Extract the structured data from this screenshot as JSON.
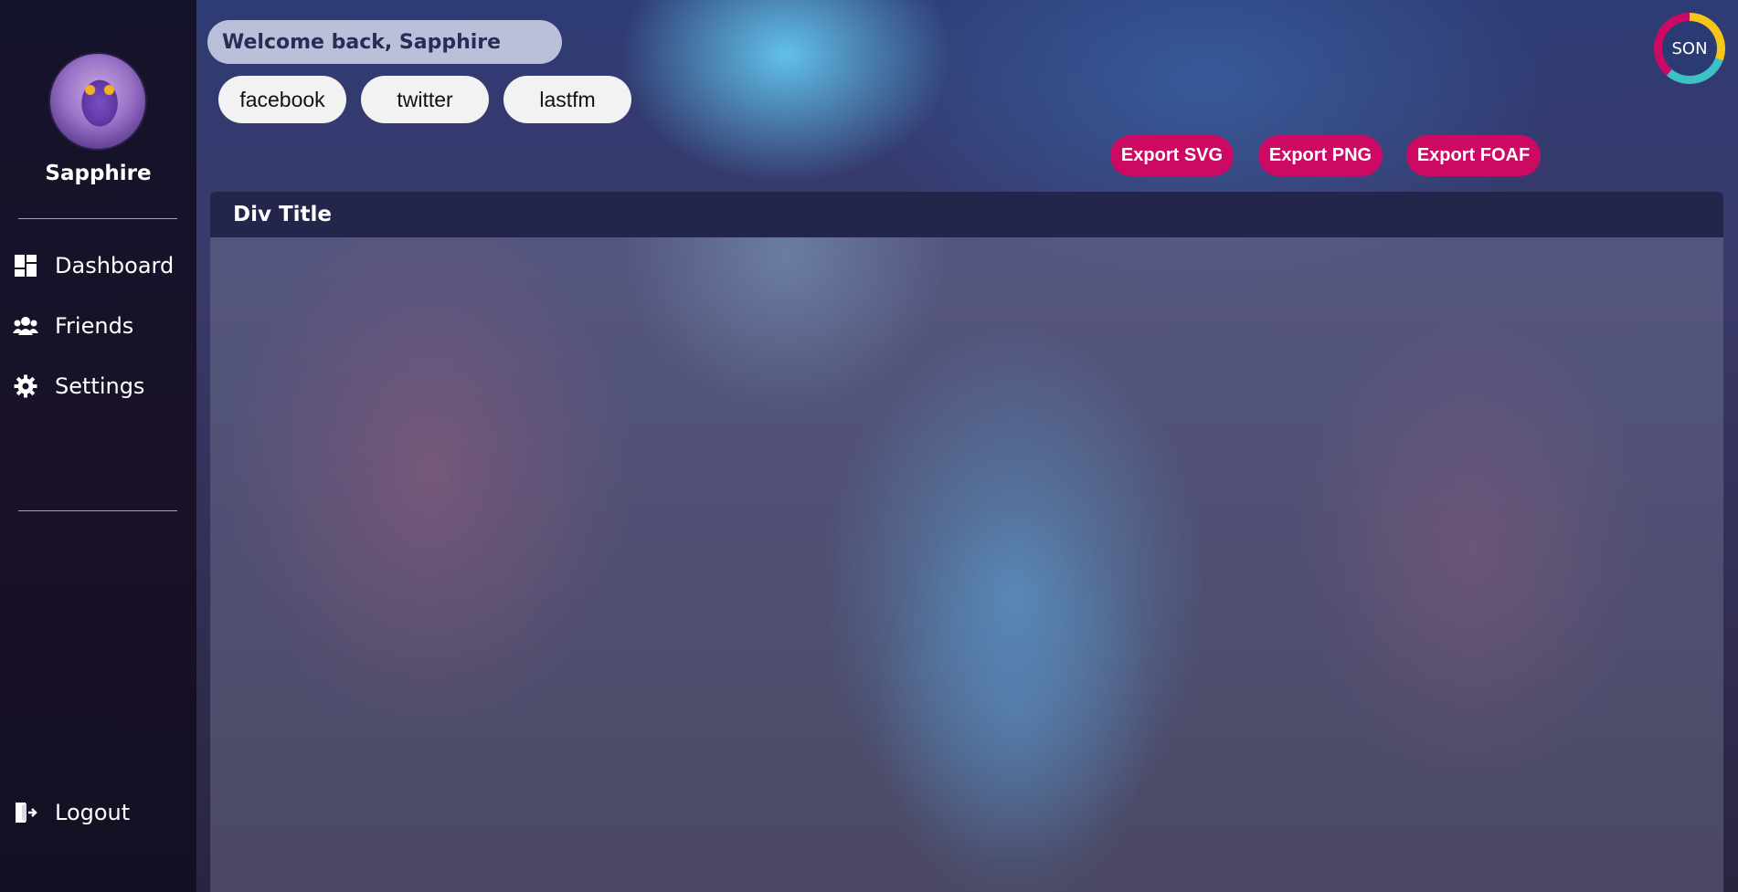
{
  "sidebar": {
    "username": "Sapphire",
    "items": [
      {
        "label": "Dashboard",
        "icon": "dashboard-icon"
      },
      {
        "label": "Friends",
        "icon": "users-icon"
      },
      {
        "label": "Settings",
        "icon": "gear-icon"
      }
    ],
    "logout": {
      "label": "Logout",
      "icon": "logout-icon"
    }
  },
  "header": {
    "welcome": "Welcome back, Sapphire",
    "social_links": [
      "facebook",
      "twitter",
      "lastfm"
    ],
    "exports": [
      "Export SVG",
      "Export PNG",
      "Export FOAF"
    ],
    "logo_text": "SON"
  },
  "main": {
    "panel_title": "Div Title"
  },
  "colors": {
    "accent": "#cc0a63",
    "sidebar_bg": "#13132a",
    "panel_header": "#23254a",
    "logo_yellow": "#f5c518",
    "logo_teal": "#3ec0c7"
  }
}
